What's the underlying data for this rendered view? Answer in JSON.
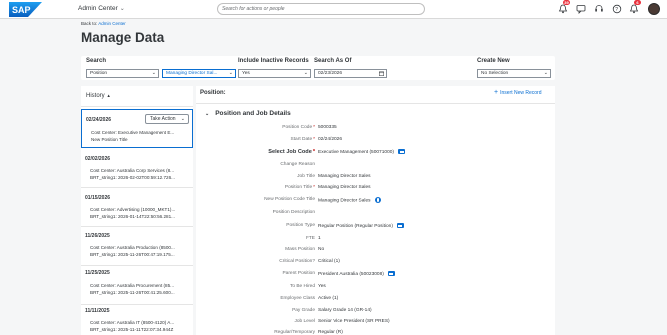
{
  "shell": {
    "logo_text": "SAP",
    "app_title": "Admin Center",
    "search_placeholder": "Search for actions or people",
    "notification_count": "39",
    "alert_count": "6"
  },
  "page": {
    "back_prefix": "Back to:",
    "back_link": "Admin Center",
    "title": "Manage Data"
  },
  "filters": {
    "search_label": "Search",
    "search_type": "Position",
    "search_value": "Managing Director Sal...",
    "inactive_label": "Include Inactive Records",
    "inactive_value": "Yes",
    "asof_label": "Search As Of",
    "asof_value": "02/23/2026",
    "create_label": "Create New",
    "create_value": "No Selection"
  },
  "history": {
    "title": "History",
    "take_action": "Take Action",
    "items": [
      {
        "date": "02/24/2026",
        "line1": "Cost Center: Executive Management E...",
        "line2": "New Position Title"
      },
      {
        "date": "02/02/2026",
        "line1": "Cost Center: Australia Corp Services (8...",
        "line2": "BRT_string1: 2026-02-02T00:59:12.726..."
      },
      {
        "date": "01/15/2026",
        "line1": "Cost Center: Advertising (10000_MKT1)...",
        "line2": "BRT_string1: 2026-01-14T22:50:56.281..."
      },
      {
        "date": "11/26/2025",
        "line1": "Cost Center: Australia Production (8500...",
        "line2": "BRT_string1: 2025-11-26T00:47:19.175..."
      },
      {
        "date": "11/25/2025",
        "line1": "Cost Center: Australia Procurement (85...",
        "line2": "BRT_string1: 2025-11-26T00:41:25.600..."
      },
      {
        "date": "11/11/2025",
        "line1": "Cost Center: Australia IT (8500-4120) A...",
        "line2": "BRT_string1: 2025-11-11T22:07:34.944Z"
      }
    ]
  },
  "main": {
    "position_label": "Position:",
    "insert_label": "Insert New Record",
    "section_title": "Position and Job Details",
    "fields": [
      {
        "label": "Position Code",
        "value": "5000335",
        "required": true
      },
      {
        "label": "Start Date",
        "value": "02/24/2026",
        "required": true
      },
      {
        "label": "Select Job Code",
        "value": "Executive Management (50071000)",
        "required": true,
        "strong": true,
        "icon": "info-icon"
      },
      {
        "label": "Change Reason",
        "value": ""
      },
      {
        "label": "Job Title",
        "value": "Managing Director Sales"
      },
      {
        "label": "Position Title",
        "value": "Managing Director Sales",
        "required": true
      },
      {
        "label": "New Position Code Title",
        "value": "Managing Director Sales",
        "icon": "globe-icon"
      },
      {
        "label": "Position Description",
        "value": ""
      },
      {
        "label": "Position Type",
        "value": "Regular Position (Regular Position)",
        "icon": "info-icon"
      },
      {
        "label": "FTE",
        "value": "1"
      },
      {
        "label": "Mass Position",
        "value": "No"
      },
      {
        "label": "Critical Position?",
        "value": "Critical (1)"
      },
      {
        "label": "Parent Position",
        "value": "President Australia (50023008)",
        "icon": "info-icon"
      },
      {
        "label": "To Be Hired",
        "value": "Yes"
      },
      {
        "label": "Employee Class",
        "value": "Active (1)"
      },
      {
        "label": "Pay Grade",
        "value": "Salary Grade 14 (GR-14)"
      },
      {
        "label": "Job Level",
        "value": "Senior Vice President (SR PRES)"
      },
      {
        "label": "Regular/Temporary",
        "value": "Regular (R)"
      }
    ]
  }
}
